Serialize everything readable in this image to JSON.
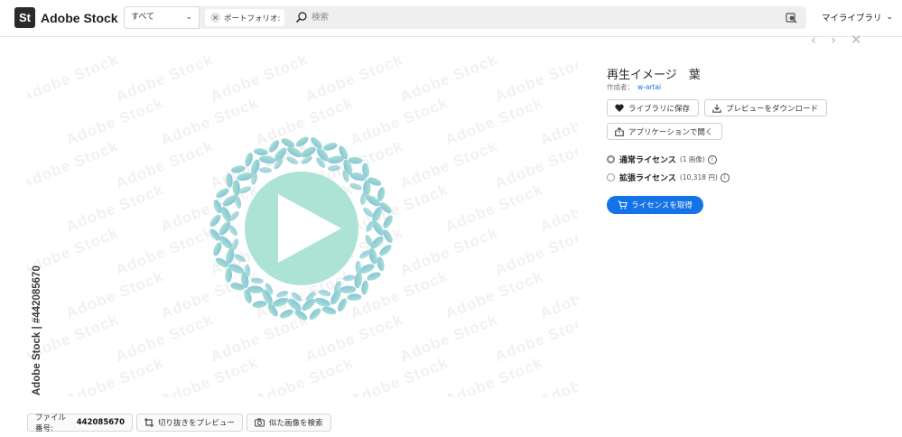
{
  "header": {
    "logo_mark": "St",
    "logo_text": "Adobe Stock",
    "scope_label": "すべて",
    "filter_chip": "ポートフォリオ:",
    "search_placeholder": "検索",
    "my_libraries": "マイライブラリ"
  },
  "preview": {
    "watermark_text": "Adobe Stock",
    "side_id": "Adobe Stock | #442085670",
    "icon": "play-icon",
    "colors": {
      "leaf_top": "#a7e0cf",
      "leaf_bottom": "#88c3dd",
      "circle": "#ade3d5"
    }
  },
  "bottom_actions": {
    "file_no_label": "ファイル番号:",
    "file_no": "442085670",
    "crop_preview": "切り抜きをプレビュー",
    "find_similar": "似た画像を検索"
  },
  "asset": {
    "title": "再生イメージ　葉",
    "author_label": "作成者：",
    "author": "w-artai",
    "save_to_library": "ライブラリに保存",
    "download_preview": "プレビューをダウンロード",
    "open_in_app": "アプリケーションで開く"
  },
  "licenses": {
    "standard_label": "通常ライセンス",
    "standard_detail": "(1 画像)",
    "extended_label": "拡張ライセンス",
    "extended_detail": "(10,318 円)",
    "selected": "standard",
    "get_license": "ライセンスを取得"
  },
  "colors": {
    "accent": "#1473e6"
  }
}
